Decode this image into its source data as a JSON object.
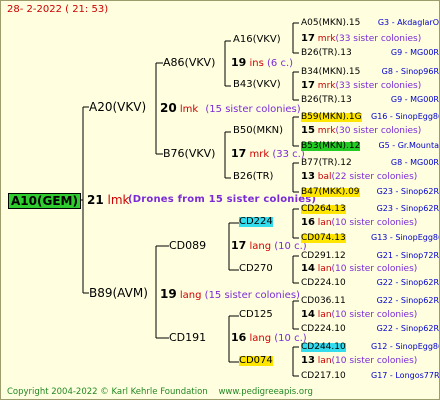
{
  "header": {
    "date": "28-  2-2022 ( 21: 53)"
  },
  "root": {
    "name": "A10(GEM)",
    "num": "21",
    "loc": "lmk",
    "drones": "(Drones from 15 sister colonies)"
  },
  "gen2": [
    {
      "name": "A20(VKV)",
      "num": "20",
      "loc": "lmk",
      "sis": "(15 sister colonies)"
    },
    {
      "name": "B89(AVM)",
      "num": "19",
      "loc": "lang",
      "sis": "(15 sister colonies)"
    }
  ],
  "gen3": [
    {
      "name": "A86(VKV)",
      "num": "19",
      "loc": "ins",
      "sis": "(6 c.)"
    },
    {
      "name": "B76(VKV)",
      "num": "17",
      "loc": "mrk",
      "sis": "(33 c.)"
    },
    {
      "name": "CD089",
      "num": "17",
      "loc": "lang",
      "sis": "(10 c.)"
    },
    {
      "name": "CD191",
      "num": "16",
      "loc": "lang",
      "sis": "(10 c.)"
    }
  ],
  "gen4": [
    {
      "name": "A16(VKV)",
      "num": "17",
      "loc": "mrk",
      "sis": "(33 sister colonies)"
    },
    {
      "name": "B43(VKV)",
      "num": "17",
      "loc": "mrk",
      "sis": "(33 sister colonies)"
    },
    {
      "name": "B50(MKN)",
      "num": "15",
      "loc": "mrk",
      "sis": "(30 sister colonies)"
    },
    {
      "name": "B26(TR)",
      "num": "13",
      "loc": "bal",
      "sis": "(22 sister colonies)"
    },
    {
      "name": "CD224",
      "num": "16",
      "loc": "lan",
      "sis": "(10 sister colonies)"
    },
    {
      "name": "CD270",
      "num": "14",
      "loc": "lan",
      "sis": "(10 sister colonies)"
    },
    {
      "name": "CD125",
      "num": "14",
      "loc": "lan",
      "sis": "(10 sister colonies)"
    },
    {
      "name": "CD074",
      "num": "13",
      "loc": "lan",
      "sis": "(10 sister colonies)"
    }
  ],
  "gen5": [
    {
      "name": "A05(MKN).15",
      "loc": "G3 - AkdaglarO"
    },
    {
      "name": "B26(TR).13",
      "loc": "G9 - MG00R"
    },
    {
      "name": "B34(MKN).15",
      "loc": "G8 - Sinop96R"
    },
    {
      "name": "B26(TR).13",
      "loc": "G9 - MG00R"
    },
    {
      "name": "B59(MKN).1G",
      "loc": "G16 - SinopEgg86R"
    },
    {
      "name": "B53(MKN).12",
      "loc": "G5 - Gr.Mounta"
    },
    {
      "name": "B77(TR).12",
      "loc": "G8 - MG00R"
    },
    {
      "name": "B47(MKK).09",
      "loc": "G23 - Sinop62R"
    },
    {
      "name": "CD264.13",
      "loc": "G23 - Sinop62R"
    },
    {
      "name": "CD074.13",
      "loc": "G13 - SinopEgg86R"
    },
    {
      "name": "CD291.12",
      "loc": "G21 - Sinop72R"
    },
    {
      "name": "CD224.10",
      "loc": "G22 - Sinop62R"
    },
    {
      "name": "CD036.11",
      "loc": "G22 - Sinop62R"
    },
    {
      "name": "CD224.10",
      "loc": "G22 - Sinop62R"
    },
    {
      "name": "CD244.10",
      "loc": "G12 - SinopEgg86R"
    },
    {
      "name": "CD217.10",
      "loc": "G17 - Longos77R"
    }
  ],
  "footer": {
    "copyright": "Copyright 2004-2022 © Karl Kehrle Foundation",
    "url": "www.pedigreeapis.org"
  }
}
